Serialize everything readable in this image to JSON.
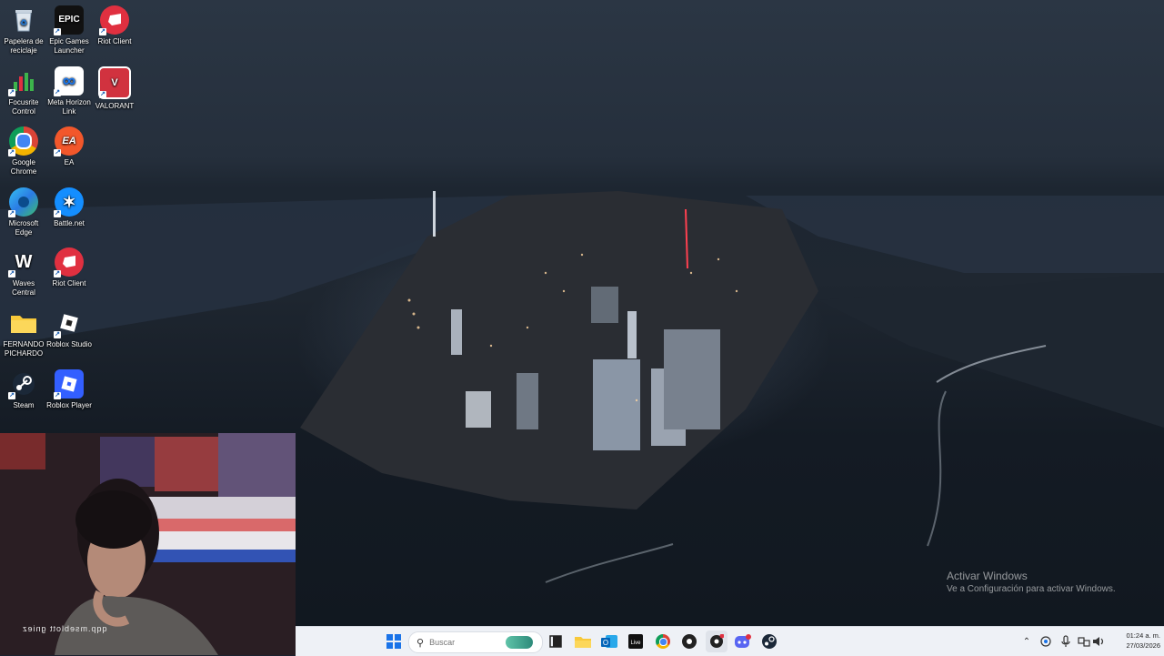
{
  "desktop": {
    "icons": [
      {
        "label": "Papelera de reciclaje",
        "icon": "recycle-bin-icon"
      },
      {
        "label": "Epic Games Launcher",
        "icon": "epic-games-icon",
        "glyph": "EPIC"
      },
      {
        "label": "Riot Client",
        "icon": "riot-client-icon"
      },
      {
        "label": "Focusrite Control",
        "icon": "focusrite-icon"
      },
      {
        "label": "Meta Horizon Link",
        "icon": "meta-icon",
        "glyph": "∞"
      },
      {
        "label": "VALORANT",
        "icon": "valorant-icon",
        "glyph": "V"
      },
      {
        "label": "Google Chrome",
        "icon": "chrome-icon"
      },
      {
        "label": "EA",
        "icon": "ea-icon",
        "glyph": "EA"
      },
      {
        "label": "Microsoft Edge",
        "icon": "edge-icon"
      },
      {
        "label": "Battle.net",
        "icon": "battlenet-icon",
        "glyph": "✶"
      },
      {
        "label": "Waves Central",
        "icon": "waves-icon",
        "glyph": "W"
      },
      {
        "label": "Riot Client",
        "icon": "riot-client-icon"
      },
      {
        "label": "FERNANDO PICHARDO",
        "icon": "folder-icon"
      },
      {
        "label": "Roblox Studio",
        "icon": "roblox-studio-icon"
      },
      {
        "label": "Steam",
        "icon": "steam-icon"
      },
      {
        "label": "Roblox Player",
        "icon": "roblox-player-icon"
      }
    ]
  },
  "watermark": {
    "title": "Activar Windows",
    "subtitle": "Ve a Configuración para activar Windows."
  },
  "webcam": {
    "overlay_text": "qqp.mseblott gniez"
  },
  "taskbar": {
    "search_placeholder": "Buscar",
    "apps": [
      "windows-start-icon",
      "task-view-icon",
      "file-explorer-icon",
      "outlook-icon",
      "live-app-icon",
      "chrome-icon",
      "obs-icon",
      "record-icon",
      "discord-icon",
      "steam-icon"
    ],
    "tray_icons": [
      "chevron-up-icon",
      "onedrive-icon",
      "microphone-icon",
      "network-icon",
      "volume-icon"
    ],
    "time": "01:24 a. m.",
    "date": "27/03/2026"
  },
  "colors": {
    "taskbar_bg": "#eef1f6",
    "start_blue": "#1a73e8"
  }
}
